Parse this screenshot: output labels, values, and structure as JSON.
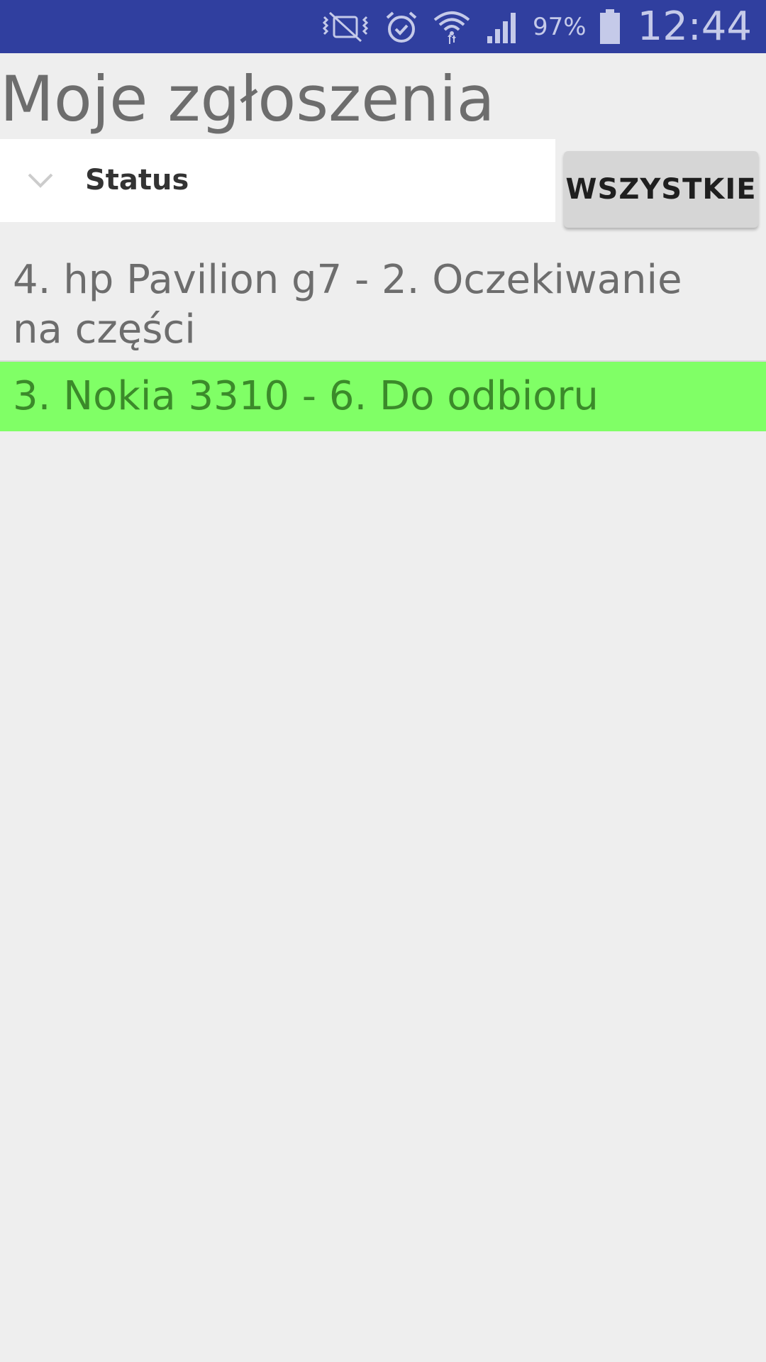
{
  "status_bar": {
    "battery_percent": "97%",
    "time": "12:44",
    "icons": [
      "vibrate-mute-icon",
      "alarm-icon",
      "wifi-icon",
      "signal-icon",
      "battery-icon"
    ]
  },
  "title": "Moje zgłoszenia",
  "filter": {
    "spinner_label": "Status",
    "all_button_label": "WSZYSTKIE"
  },
  "list": {
    "items": [
      {
        "text": "4. hp Pavilion g7 - 2. Oczekiwanie na części",
        "highlight": false
      },
      {
        "text": "3. Nokia 3310 - 6. Do odbioru",
        "highlight": true,
        "highlight_color": "#80ff66"
      }
    ]
  },
  "colors": {
    "status_bar": "#303f9f",
    "background": "#eeeeee",
    "highlight": "#80ff66",
    "highlight_text": "#3b8a2a"
  }
}
